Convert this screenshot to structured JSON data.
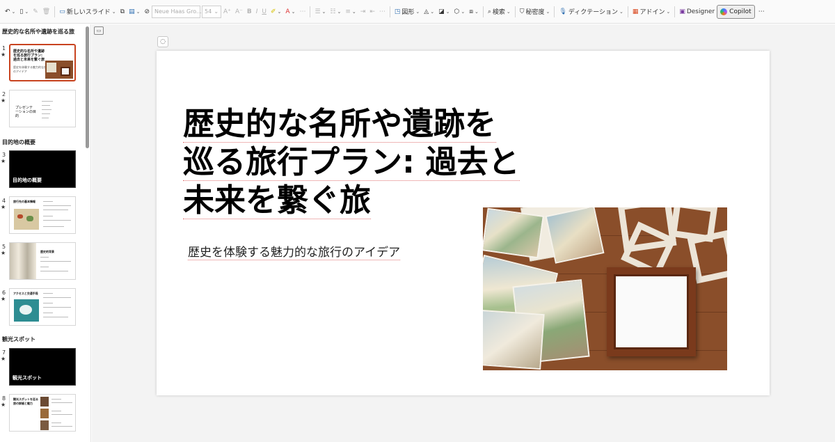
{
  "toolbar": {
    "undo_icon": "undo-icon",
    "new_slide": "新しいスライド",
    "font_name": "Neue Haas Gro...",
    "font_size": "54",
    "shapes": "図形",
    "search": "検索",
    "sensitivity": "秘密度",
    "dictation": "ディクテーション",
    "addins": "アドイン",
    "designer": "Designer",
    "copilot": "Copilot",
    "more": "⋯"
  },
  "sections": [
    {
      "title": "歴史的な名所や遺跡を巡る旅"
    },
    {
      "title": "目的地の概要"
    },
    {
      "title": "観光スポット"
    }
  ],
  "thumbnails": [
    {
      "num": "1",
      "title": "歴史的な名所や遺跡を巡る旅行プラン: 過去と未来を繋ぐ旅",
      "sub": "歴史を体験する魅力的な旅行のアイデア"
    },
    {
      "num": "2",
      "title": "プレゼンテーションの目的"
    },
    {
      "num": "3",
      "title": "目的地の概要"
    },
    {
      "num": "4",
      "title": "旅行先の基本情報"
    },
    {
      "num": "5",
      "title": "歴史的背景"
    },
    {
      "num": "6",
      "title": "アクセスと交通手段"
    },
    {
      "num": "7",
      "title": "観光スポット"
    },
    {
      "num": "8",
      "title": "観光スポットを巡る旅の詳細と魅力"
    }
  ],
  "star": "★",
  "slide": {
    "title_lines": [
      "歴史的な名所や遺跡を",
      "巡る旅行プラン: 過去と",
      "未来を繋ぐ旅"
    ],
    "subtitle": "歴史を体験する魅力的な旅行のアイデア"
  },
  "colors": {
    "selected_border": "#c8431f",
    "frame_wood": "#7a3a1c",
    "table_wood": "#8a4e2a"
  }
}
